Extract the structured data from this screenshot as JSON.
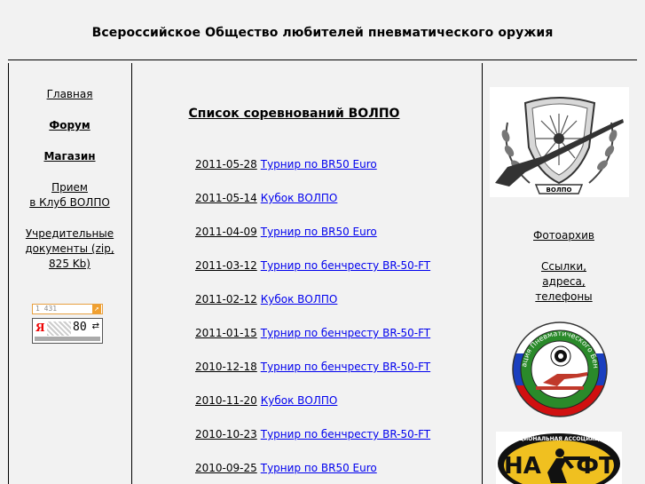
{
  "header": {
    "title": "Всероссийское Общество любителей пневматического оружия"
  },
  "left_nav": {
    "items": [
      {
        "label": "Главная"
      },
      {
        "label": "Форум"
      },
      {
        "label": "Магазин"
      },
      {
        "label_line1": "Прием",
        "label_line2": "в Клуб ВОЛПО"
      },
      {
        "label_line1": "Учредительные",
        "label_line2": "документы (zip,",
        "label_line3": "825 Kb)"
      }
    ],
    "counter_hits": "1 431",
    "counter_value": "80"
  },
  "main": {
    "title": "Список соревнований ВОЛПО",
    "competitions": [
      {
        "date": "2011-05-28",
        "name": "Турнир по BR50 Euro"
      },
      {
        "date": "2011-05-14",
        "name": "Кубок ВОЛПО"
      },
      {
        "date": "2011-04-09",
        "name": "Турнир по BR50 Euro"
      },
      {
        "date": "2011-03-12",
        "name": "Турнир по бенчресту BR-50-FT"
      },
      {
        "date": "2011-02-12",
        "name": "Кубок ВОЛПО"
      },
      {
        "date": "2011-01-15",
        "name": "Турнир по бенчресту BR-50-FT"
      },
      {
        "date": "2010-12-18",
        "name": "Турнир по бенчресту BR-50-FT"
      },
      {
        "date": "2010-11-20",
        "name": "Кубок ВОЛПО"
      },
      {
        "date": "2010-10-23",
        "name": "Турнир по бенчресту BR-50-FT"
      },
      {
        "date": "2010-09-25",
        "name": "Турнир по BR50 Euro"
      }
    ]
  },
  "right_nav": {
    "items": [
      {
        "label": "Фотоархив"
      },
      {
        "label_line1": "Ссылки,",
        "label_line2": "адреса,",
        "label_line3": "телефоны"
      }
    ],
    "emblem_text": "ВОЛПО",
    "badge_text": "Ассоциация Пневматического Бенчреста",
    "naft_top": "НАЦИОНАЛЬНАЯ АССОЦИАЦИЯ",
    "naft_left": "НА",
    "naft_right": "ФТ"
  }
}
